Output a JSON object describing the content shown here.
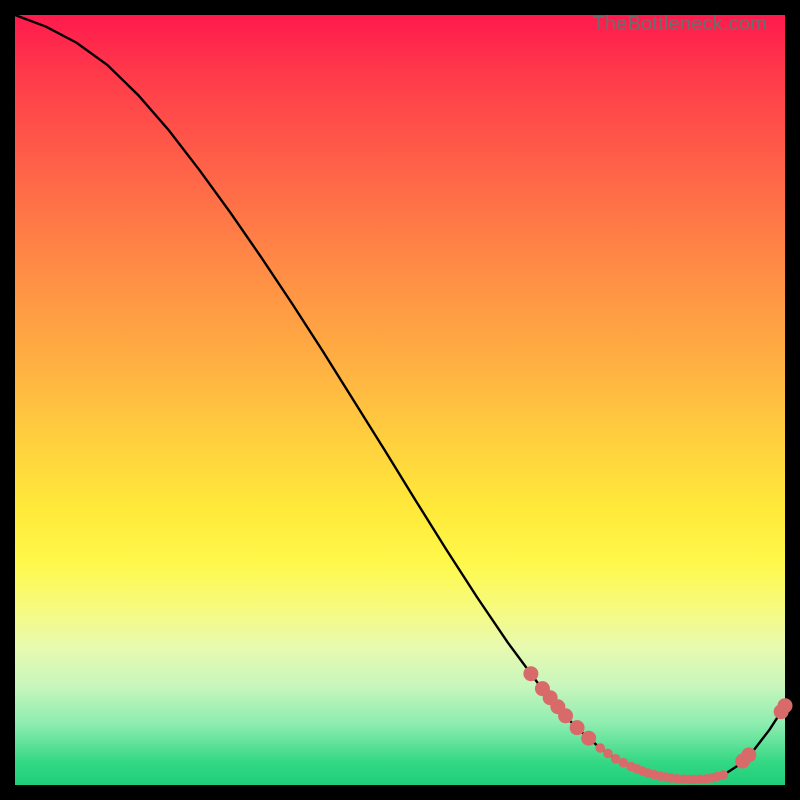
{
  "watermark": "TheBottleneck.com",
  "chart_data": {
    "type": "line",
    "title": "",
    "xlabel": "",
    "ylabel": "",
    "xlim": [
      0,
      100
    ],
    "ylim": [
      0,
      100
    ],
    "curve": {
      "x": [
        0,
        4,
        8,
        12,
        16,
        20,
        24,
        28,
        32,
        36,
        40,
        44,
        48,
        52,
        56,
        60,
        64,
        68,
        72,
        74,
        76,
        78,
        80,
        82,
        84,
        86,
        88,
        90,
        92,
        94,
        96,
        98,
        100
      ],
      "y": [
        100,
        98.5,
        96.4,
        93.5,
        89.6,
        85.0,
        79.8,
        74.3,
        68.5,
        62.5,
        56.3,
        49.9,
        43.5,
        37.0,
        30.6,
        24.4,
        18.5,
        13.1,
        8.4,
        6.5,
        4.8,
        3.4,
        2.4,
        1.6,
        1.1,
        0.8,
        0.7,
        0.8,
        1.3,
        2.6,
        4.6,
        7.2,
        10.3
      ]
    },
    "marker_cluster": {
      "note": "salmon dots along the curve, dense in the valley, sparse on the rising tail",
      "x": [
        67,
        68.5,
        69.5,
        70.5,
        71.5,
        73,
        74.5,
        76,
        77,
        78,
        79,
        80,
        80.8,
        81.5,
        82.2,
        83,
        83.8,
        84.5,
        85.2,
        86,
        86.8,
        87.5,
        88.2,
        89,
        89.8,
        90.5,
        91.2,
        92,
        94.5,
        95.3,
        99.5,
        100
      ],
      "r_large_at": [
        67,
        68.5,
        69.5,
        70.5,
        71.5,
        73,
        74.5,
        94.5,
        95.3,
        99.5,
        100
      ]
    },
    "colors": {
      "curve": "#000000",
      "marker": "#d96a6a",
      "background_top": "#ff1a4d",
      "background_bottom": "#1fce7a"
    }
  }
}
